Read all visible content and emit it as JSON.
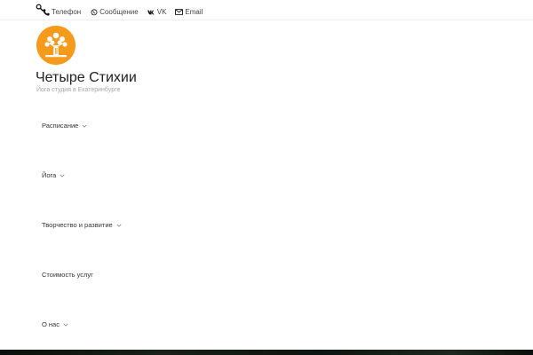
{
  "header": {
    "search_icon": "search-icon",
    "contacts": [
      {
        "icon": "phone-icon",
        "label": "Телефон"
      },
      {
        "icon": "whatsapp-icon",
        "label": "Сообщение"
      },
      {
        "icon": "vk-icon",
        "label": "VK"
      },
      {
        "icon": "mail-icon",
        "label": "Email"
      }
    ]
  },
  "branding": {
    "logo_icon": "tree-logo-icon",
    "logo_color": "#f59a1b",
    "site_title": "Четыре Стихии",
    "tagline": "Йога студия в Екатеринбурге"
  },
  "menu": {
    "items": [
      {
        "label": "Расписание",
        "has_submenu": true
      },
      {
        "label": "Йога",
        "has_submenu": true
      },
      {
        "label": "Творчество и развитие",
        "has_submenu": true
      },
      {
        "label": "Стоимость услуг",
        "has_submenu": false
      },
      {
        "label": "О нас",
        "has_submenu": true
      }
    ]
  }
}
